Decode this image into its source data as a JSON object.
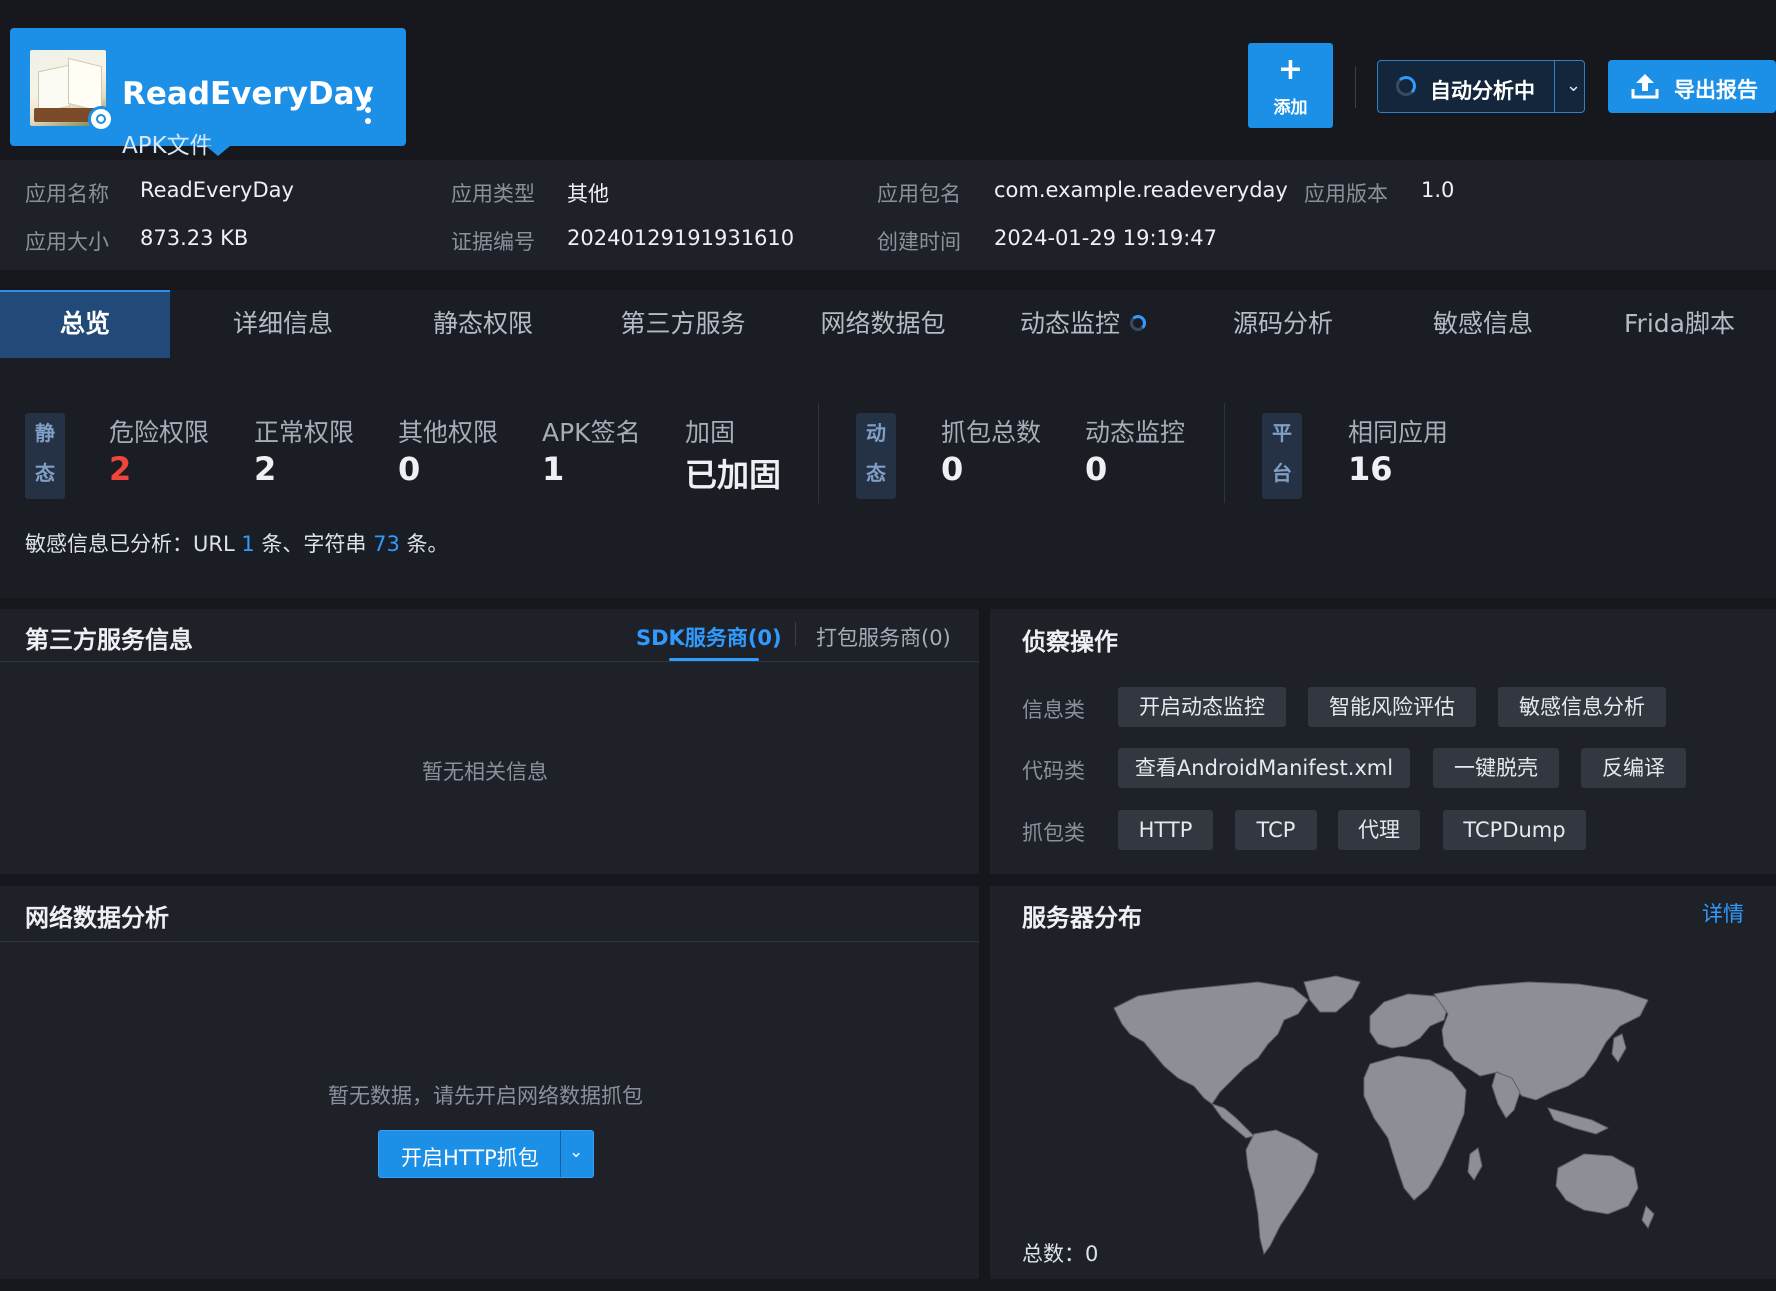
{
  "app": {
    "name": "ReadEveryDay",
    "type_label": "APK文件"
  },
  "header_actions": {
    "add_label": "添加",
    "add_icon": "plus-icon",
    "auto_label": "自动分析中",
    "export_label": "导出报告",
    "accent_color": "#1c8fe6"
  },
  "info": {
    "app_name_key": "应用名称",
    "app_name_val": "ReadEveryDay",
    "app_type_key": "应用类型",
    "app_type_val": "其他",
    "package_key": "应用包名",
    "package_val": "com.example.readeveryday",
    "version_key": "应用版本",
    "version_val": "1.0",
    "size_key": "应用大小",
    "size_val": "873.23 KB",
    "evidence_key": "证据编号",
    "evidence_val": "20240129191931610",
    "created_key": "创建时间",
    "created_val": "2024-01-29 19:19:47"
  },
  "tabs": [
    {
      "label": "总览",
      "active": true
    },
    {
      "label": "详细信息"
    },
    {
      "label": "静态权限"
    },
    {
      "label": "第三方服务"
    },
    {
      "label": "网络数据包"
    },
    {
      "label": "动态监控",
      "loading": true
    },
    {
      "label": "源码分析"
    },
    {
      "label": "敏感信息"
    },
    {
      "label": "Frida脚本"
    }
  ],
  "stats": {
    "static_tag": [
      "静",
      "态"
    ],
    "dynamic_tag": [
      "动",
      "态"
    ],
    "platform_tag": [
      "平",
      "台"
    ],
    "danger_label": "危险权限",
    "danger_val": "2",
    "normal_label": "正常权限",
    "normal_val": "2",
    "other_label": "其他权限",
    "other_val": "0",
    "sign_label": "APK签名",
    "sign_val": "1",
    "harden_label": "加固",
    "harden_val": "已加固",
    "capture_label": "抓包总数",
    "capture_val": "0",
    "monitor_label": "动态监控",
    "monitor_val": "0",
    "same_label": "相同应用",
    "same_val": "16",
    "danger_color": "#f0453b"
  },
  "sensitive": {
    "prefix": "敏感信息已分析：URL ",
    "url_count": "1",
    "mid": " 条、字符串 ",
    "string_count": "73",
    "suffix": " 条。"
  },
  "third_party": {
    "title": "第三方服务信息",
    "sdk_tab": "SDK服务商(0)",
    "pack_tab": "打包服务商(0)",
    "empty": "暂无相关信息"
  },
  "recon": {
    "title": "侦察操作",
    "info_label": "信息类",
    "code_label": "代码类",
    "capture_label": "抓包类",
    "info_buttons": [
      "开启动态监控",
      "智能风险评估",
      "敏感信息分析"
    ],
    "code_buttons": [
      "查看AndroidManifest.xml",
      "一键脱壳",
      "反编译"
    ],
    "capture_buttons": [
      "HTTP",
      "TCP",
      "代理",
      "TCPDump"
    ]
  },
  "network": {
    "title": "网络数据分析",
    "empty": "暂无数据，请先开启网络数据抓包",
    "button": "开启HTTP抓包"
  },
  "servers": {
    "title": "服务器分布",
    "detail_link": "详情",
    "total": "总数：0"
  }
}
